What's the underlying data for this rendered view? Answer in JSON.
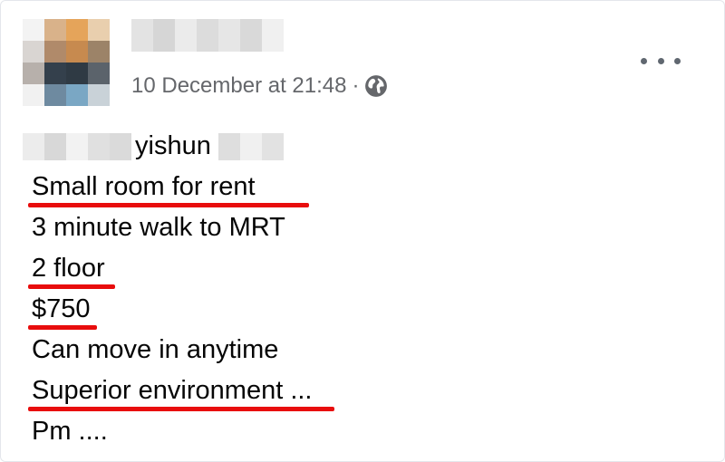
{
  "post": {
    "timestamp": "10 December at 21:48",
    "separator": "·",
    "privacy_icon": "globe-icon",
    "more_icon": "more-horizontal-icon",
    "lines": [
      "yishun",
      "Small room for rent",
      "3 minute walk to MRT",
      "2 floor",
      "$750",
      "Can move in anytime",
      "Superior environment ...",
      "Pm ...."
    ]
  },
  "colors": {
    "annotation_underline": "#e80d0d",
    "timestamp_text": "#65676b",
    "body_text": "#050505"
  }
}
